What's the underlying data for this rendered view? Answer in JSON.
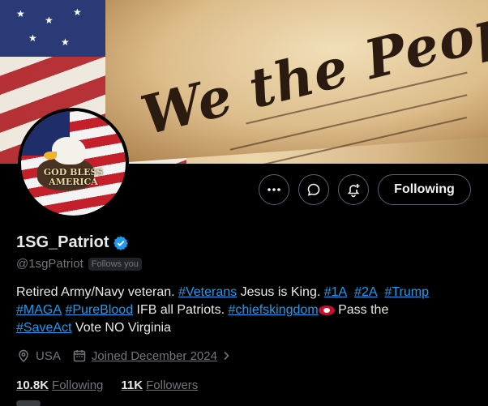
{
  "banner": {
    "headline": "We the People"
  },
  "avatar": {
    "text": "GOD BLESS AMERICA"
  },
  "actions": {
    "more_icon": "more-icon",
    "message_icon": "message-icon",
    "notify_icon": "bell-plus-icon",
    "following_label": "Following"
  },
  "profile": {
    "display_name": "1SG_Patriot",
    "handle": "@1sgPatriot",
    "follows_you": "Follows you",
    "location": "USA",
    "joined": "Joined December 2024",
    "following_count": "10.8K",
    "following_label": "Following",
    "followers_count": "11K",
    "followers_label": "Followers"
  },
  "bio": {
    "t1": "Retired Army/Navy veteran. ",
    "tag_veterans": "#Veterans",
    "t2": " Jesus is King. ",
    "tag_1a": "#1A",
    "tag_2a": "#2A",
    "tag_trump": "#Trump",
    "tag_maga": "#MAGA",
    "tag_pureblood": "#PureBlood",
    "t3": "  IFB all Patriots.  ",
    "tag_chiefs": "#chiefskingdom",
    "t4": " Pass the",
    "tag_saveact": "#SaveAct",
    "t5": " Vote NO Virginia"
  },
  "colors": {
    "accent": "#1d9bf0",
    "verified": "#1d9bf0",
    "muted": "#71767b"
  }
}
